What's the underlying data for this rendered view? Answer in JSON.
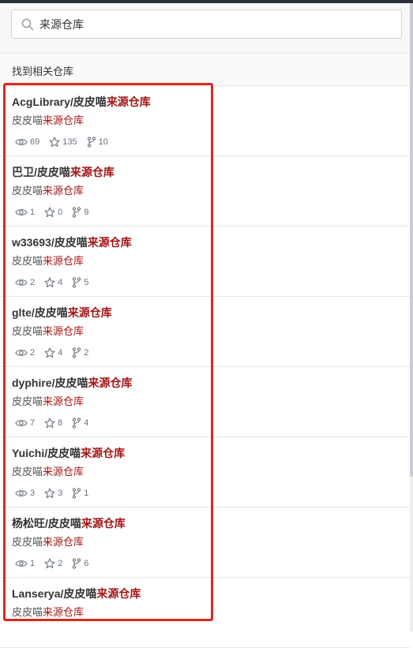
{
  "search": {
    "query": "来源仓库"
  },
  "results_header": "找到相关仓库",
  "repos": [
    {
      "owner": "AcgLibrary/皮皮喵",
      "highlight": "来源仓库",
      "desc_prefix": "皮皮喵",
      "desc_highlight": "来源仓库",
      "watch": "69",
      "stars": "135",
      "forks": "10"
    },
    {
      "owner": "巴卫/皮皮喵",
      "highlight": "来源仓库",
      "desc_prefix": "皮皮喵",
      "desc_highlight": "来源仓库",
      "watch": "1",
      "stars": "0",
      "forks": "9"
    },
    {
      "owner": "w33693/皮皮喵",
      "highlight": "来源仓库",
      "desc_prefix": "皮皮喵",
      "desc_highlight": "来源仓库",
      "watch": "2",
      "stars": "4",
      "forks": "5"
    },
    {
      "owner": "glte/皮皮喵",
      "highlight": "来源仓库",
      "desc_prefix": "皮皮喵",
      "desc_highlight": "来源仓库",
      "watch": "2",
      "stars": "4",
      "forks": "2"
    },
    {
      "owner": "dyphire/皮皮喵",
      "highlight": "来源仓库",
      "desc_prefix": "皮皮喵",
      "desc_highlight": "来源仓库",
      "watch": "7",
      "stars": "8",
      "forks": "4"
    },
    {
      "owner": "Yuichi/皮皮喵",
      "highlight": "来源仓库",
      "desc_prefix": "皮皮喵",
      "desc_highlight": "来源仓库",
      "watch": "3",
      "stars": "3",
      "forks": "1"
    },
    {
      "owner": "杨松旺/皮皮喵",
      "highlight": "来源仓库",
      "desc_prefix": "皮皮喵",
      "desc_highlight": "来源仓库",
      "watch": "1",
      "stars": "2",
      "forks": "6"
    },
    {
      "owner": "Lanserya/皮皮喵",
      "highlight": "来源仓库",
      "desc_prefix": "皮皮喵",
      "desc_highlight": "来源仓库",
      "watch": "",
      "stars": "",
      "forks": ""
    }
  ],
  "colors": {
    "highlight": "#a31515",
    "annotation_box": "#e0261e"
  },
  "icons": {
    "search": "search-icon",
    "watch": "eye-icon",
    "star": "star-icon",
    "fork": "fork-icon"
  }
}
